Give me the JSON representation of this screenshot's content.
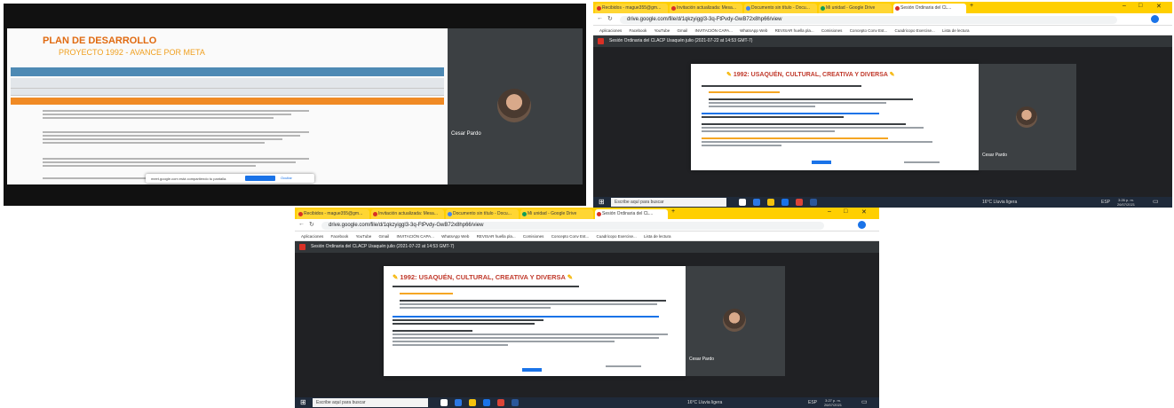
{
  "screen1": {
    "slide": {
      "title": "PLAN DE DESARROLLO",
      "subtitle": "PROYECTO 1992 - AVANCE POR META"
    },
    "share_popup": {
      "message": "meet.google.com está compartiendo tu pantalla.",
      "stop_button": "Dejar de compartir",
      "hide_button": "Ocultar"
    },
    "participant": {
      "name": "Cesar Pardo"
    }
  },
  "screen2": {
    "tabs": [
      {
        "label": "Recibidos - mague355@gm...",
        "color": "#d93025"
      },
      {
        "label": "Invitación actualizada: Mesa...",
        "color": "#d93025"
      },
      {
        "label": "Documento sin título - Docu...",
        "color": "#4285f4"
      },
      {
        "label": "Mi unidad - Google Drive",
        "color": "#0f9d58"
      },
      {
        "label": "Sesión Ordinaria del CL...",
        "color": "#d93025"
      }
    ],
    "url": "drive.google.com/file/d/1qkzyiggl3-3q-FtPvdy-GwB72x8hp66/view",
    "bookmarks": [
      "Aplicaciones",
      "Facebook",
      "YouTube",
      "Gmail",
      "INVITACIÓN CAPA...",
      "WhatsApp Web",
      "REVISAR huella pla...",
      "Comisiones",
      "Concepto Conv Est...",
      "Cuadricopo Exercise...",
      "Lista de lectura"
    ],
    "viewer_title": "Sesión Ordinaria del CLACP Usaquén julio (2021-07-22 at 14:53 GMT-7)",
    "doc_title": "1992: USAQUÉN, CULTURAL, CREATIVA Y DIVERSA",
    "participant": {
      "name": "Cesar Pardo"
    },
    "taskbar": {
      "search_placeholder": "Escribe aquí para buscar",
      "weather": "16°C Lluvia ligera",
      "lang": "ESP",
      "time": "3:26 p. m.",
      "date": "26/07/2021"
    }
  },
  "screen3": {
    "tabs": [
      {
        "label": "Recibidos - mague355@gm...",
        "color": "#d93025"
      },
      {
        "label": "Invitación actualizada: Mesa...",
        "color": "#d93025"
      },
      {
        "label": "Documento sin título - Docu...",
        "color": "#4285f4"
      },
      {
        "label": "Mi unidad - Google Drive",
        "color": "#0f9d58"
      },
      {
        "label": "Sesión Ordinaria del CL...",
        "color": "#d93025"
      }
    ],
    "url": "drive.google.com/file/d/1qkzyiggl3-3q-FtPvdy-GwB72x8hp66/view",
    "bookmarks": [
      "Aplicaciones",
      "Facebook",
      "YouTube",
      "Gmail",
      "INVITACIÓN CAPA...",
      "WhatsApp Web",
      "REVISAR huella pla...",
      "Comisiones",
      "Concepto Conv Est...",
      "Cuadricopo Exercise...",
      "Lista de lectura"
    ],
    "viewer_title": "Sesión Ordinaria del CLACP Usaquén julio (2021-07-22 at 14:53 GMT-7)",
    "doc_title": "1992: USAQUÉN, CULTURAL, CREATIVA Y DIVERSA",
    "participant": {
      "name": "Cesar Pardo"
    },
    "taskbar": {
      "search_placeholder": "Escribe aquí para buscar",
      "weather": "16°C Lluvia ligera",
      "lang": "ESP",
      "time": "3:27 p. m.",
      "date": "26/07/2021"
    }
  }
}
